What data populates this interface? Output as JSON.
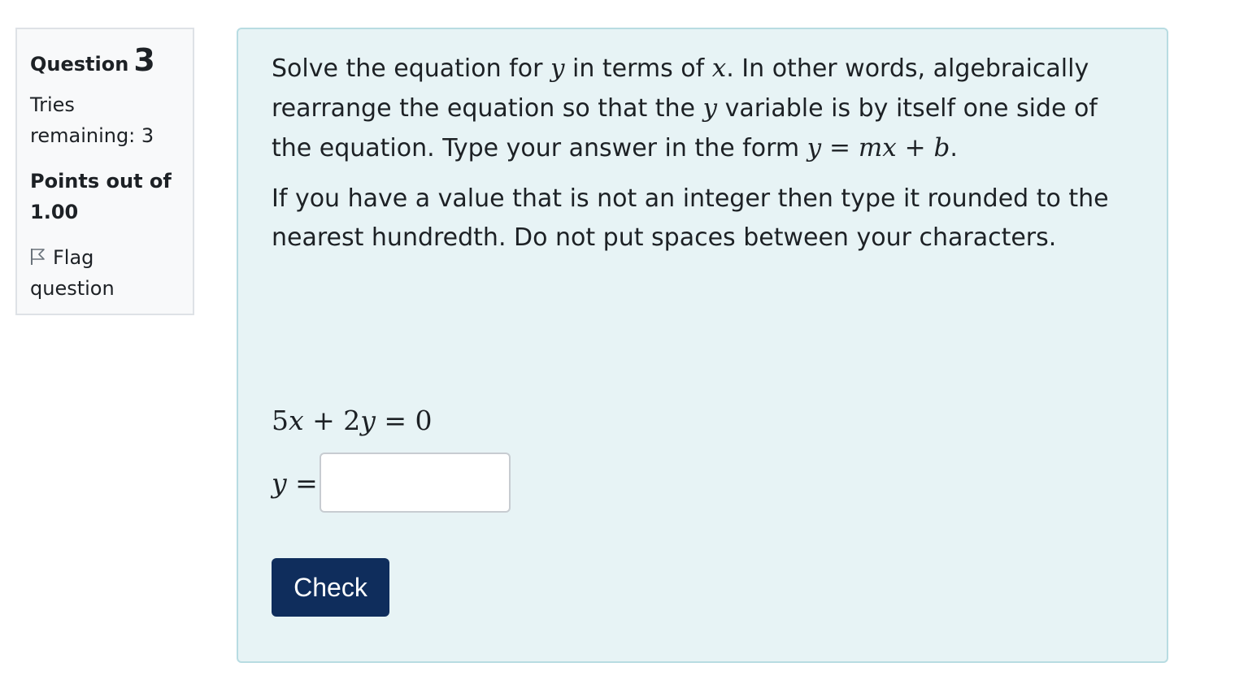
{
  "info": {
    "question_word": "Question",
    "question_number": "3",
    "tries_line1": "Tries",
    "tries_line2": "remaining: 3",
    "points_line1": "Points out of",
    "points_line2": "1.00",
    "flag_line1": "Flag",
    "flag_line2": "question",
    "flag_icon": "flag-outline-icon"
  },
  "question": {
    "p1_a": "Solve the equation for ",
    "p1_var_y": "y",
    "p1_b": " in terms of ",
    "p1_var_x": "x",
    "p1_c": ". In other words, algebraically rearrange the equation so that the ",
    "p1_var_y2": "y",
    "p1_d": " variable is by itself one side of the equation. Type your answer in the form ",
    "form_y": "y",
    "form_eq": " = ",
    "form_mx": "mx",
    "form_plus": " + ",
    "form_b": "b",
    "p1_e": ".",
    "p2": "If you have a value that is not an integer then type it rounded to the nearest hundredth. Do not put spaces between your characters.",
    "equation_5": "5",
    "equation_x": "x",
    "equation_plus": " + 2",
    "equation_y": "y",
    "equation_rest": " = 0",
    "answer_var": "y",
    "answer_eq": " =",
    "answer_value": "",
    "check_label": "Check"
  },
  "colors": {
    "content_bg": "#e7f3f5",
    "content_border": "#b8dce2",
    "info_bg": "#f8f9fa",
    "button_bg": "#0f2d5c",
    "button_text": "#ffffff"
  }
}
